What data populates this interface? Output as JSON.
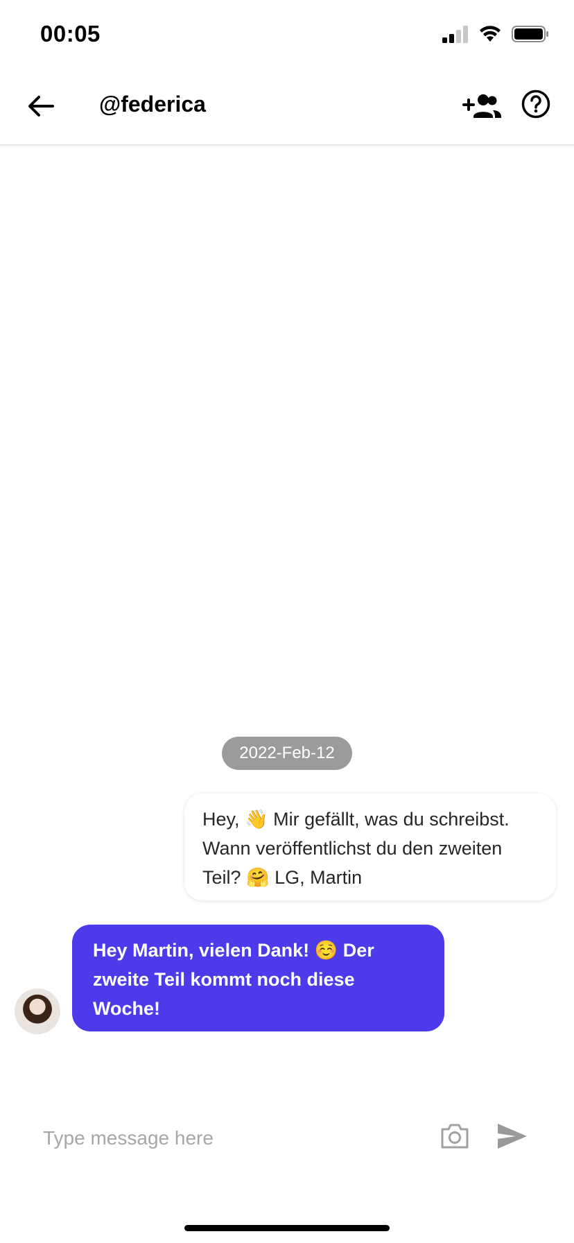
{
  "status_bar": {
    "time": "00:05"
  },
  "header": {
    "title": "@federica"
  },
  "chat": {
    "date": "2022-Feb-12",
    "messages": [
      {
        "direction": "outgoing",
        "text": "Hey, 👋 Mir gefällt, was du schreibst. Wann veröffentlichst du den zweiten Teil? 🤗 LG, Martin"
      },
      {
        "direction": "incoming",
        "text": "Hey Martin, vielen Dank! ☺️ Der zweite Teil kommt noch diese Woche!"
      }
    ]
  },
  "composer": {
    "placeholder": "Type message here",
    "value": ""
  },
  "colors": {
    "accent": "#4d3aeb",
    "date_pill": "#9b9b9b"
  },
  "icons": [
    "back-arrow-icon",
    "add-friend-icon",
    "help-icon",
    "camera-icon",
    "send-icon"
  ]
}
